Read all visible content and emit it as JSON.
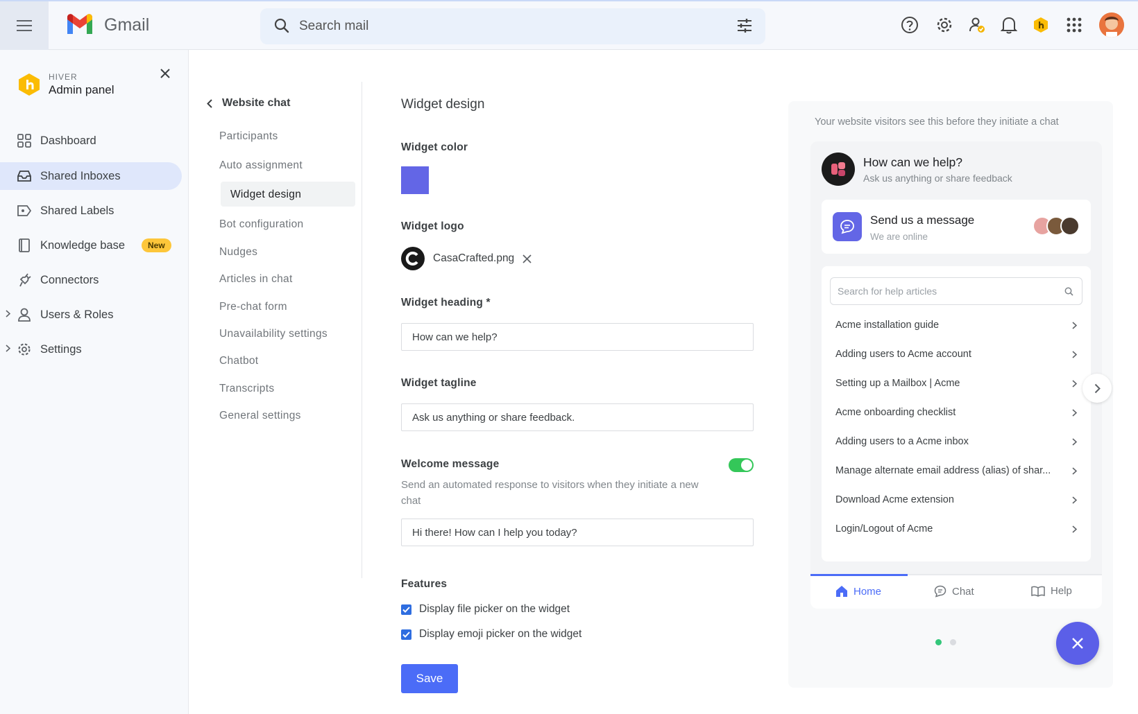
{
  "app": {
    "name": "Gmail"
  },
  "search": {
    "placeholder": "Search mail"
  },
  "sidebar": {
    "brand_small": "HIVER",
    "brand_title": "Admin panel",
    "items": [
      {
        "label": "Dashboard"
      },
      {
        "label": "Shared Inboxes"
      },
      {
        "label": "Shared Labels"
      },
      {
        "label": "Knowledge base",
        "badge": "New"
      },
      {
        "label": "Connectors"
      },
      {
        "label": "Users & Roles"
      },
      {
        "label": "Settings"
      }
    ]
  },
  "subnav": {
    "back_label": "Website chat",
    "items": [
      {
        "label": "Participants"
      },
      {
        "label": "Auto assignment"
      },
      {
        "label": "Widget design"
      },
      {
        "label": "Bot configuration"
      },
      {
        "label": "Nudges"
      },
      {
        "label": "Articles in chat"
      },
      {
        "label": "Pre-chat form"
      },
      {
        "label": "Unavailability settings"
      },
      {
        "label": "Chatbot"
      },
      {
        "label": "Transcripts"
      },
      {
        "label": "General settings"
      }
    ]
  },
  "form": {
    "title": "Widget design",
    "color_label": "Widget color",
    "color_value": "#6366e6",
    "logo_label": "Widget logo",
    "logo_file": "CasaCrafted.png",
    "heading_label": "Widget heading *",
    "heading_value": "How can we help?",
    "tagline_label": "Widget tagline",
    "tagline_value": "Ask us anything or share feedback.",
    "welcome_label": "Welcome message",
    "welcome_enabled": true,
    "welcome_desc": "Send an automated response to visitors when they initiate a new chat",
    "welcome_value": "Hi there! How can I help you today?",
    "features_label": "Features",
    "feature_1": "Display file picker on the widget",
    "feature_1_checked": true,
    "feature_2": "Display emoji picker on the widget",
    "feature_2_checked": true,
    "save_label": "Save"
  },
  "preview": {
    "caption": "Your website visitors see this before they initiate a chat",
    "heading": "How can we help?",
    "tagline": "Ask us anything or share feedback",
    "message_title": "Send us a message",
    "message_status": "We are online",
    "help_search_placeholder": "Search for help articles",
    "articles": [
      "Acme installation guide",
      "Adding users to Acme account",
      "Setting up a Mailbox | Acme",
      "Acme onboarding checklist",
      "Adding users to a Acme inbox",
      "Manage alternate email address (alias) of shar...",
      "Download Acme extension",
      "Login/Logout of Acme"
    ],
    "tabs": [
      {
        "label": "Home"
      },
      {
        "label": "Chat"
      },
      {
        "label": "Help"
      }
    ]
  },
  "colors": {
    "accent": "#4b6cf7",
    "widget": "#6366e6",
    "toggle_on": "#34c759",
    "badge": "#fdc63a"
  }
}
